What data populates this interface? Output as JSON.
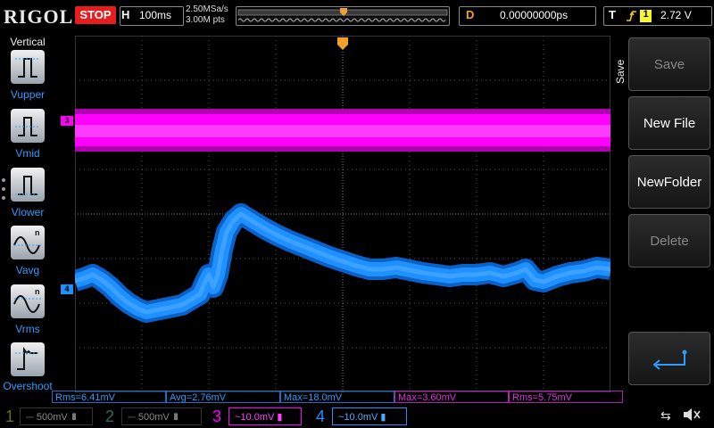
{
  "brand": "RIGOL",
  "run_state": "STOP",
  "horizontal": {
    "label": "H",
    "timebase": "100ms",
    "sample_rate": "2.50MSa/s",
    "points": "3.00M pts"
  },
  "delay": {
    "label": "D",
    "value": "0.00000000ps"
  },
  "trigger": {
    "label": "T",
    "source": "1",
    "level": "2.72 V"
  },
  "vertical_menu": {
    "title": "Vertical",
    "items": [
      {
        "label": "Vupper",
        "icon": "vupper-icon"
      },
      {
        "label": "Vmid",
        "icon": "vmid-icon"
      },
      {
        "label": "Vlower",
        "icon": "vlower-icon"
      },
      {
        "label": "Vavg",
        "icon": "vavg-icon"
      },
      {
        "label": "Vrms",
        "icon": "vrms-icon"
      },
      {
        "label": "Overshoot",
        "icon": "overshoot-icon"
      }
    ]
  },
  "save_menu": {
    "title": "Save",
    "buttons": [
      {
        "label": "Save",
        "enabled": false
      },
      {
        "label": "New File",
        "enabled": true
      },
      {
        "label": "NewFolder",
        "enabled": true
      },
      {
        "label": "Delete",
        "enabled": false
      }
    ],
    "enter_icon": "enter-return-icon"
  },
  "channel_markers": {
    "ch3": "3",
    "ch4": "4"
  },
  "measurements": [
    {
      "text": "Rms=6.41mV",
      "color": "#2e9cff"
    },
    {
      "text": "Avg=2.76mV",
      "color": "#2e9cff"
    },
    {
      "text": "Max=18.0mV",
      "color": "#2e9cff"
    },
    {
      "text": "Max=3.60mV",
      "color": "#e030e0"
    },
    {
      "text": "Rms=5.75mV",
      "color": "#e030e0"
    }
  ],
  "channels": [
    {
      "num": "1",
      "scale": "500mV",
      "active": false
    },
    {
      "num": "2",
      "scale": "500mV",
      "active": false
    },
    {
      "num": "3",
      "scale": "10.0mV",
      "coupling": "~",
      "active": true
    },
    {
      "num": "4",
      "scale": "10.0mV",
      "coupling": "~",
      "active": true
    }
  ],
  "colors": {
    "ch1": "#f7f72a",
    "ch2": "#21e8c8",
    "ch3": "#ff00ff",
    "ch4": "#1e90ff",
    "trigger": "#f2a02c",
    "stop": "#e81e1e"
  }
}
